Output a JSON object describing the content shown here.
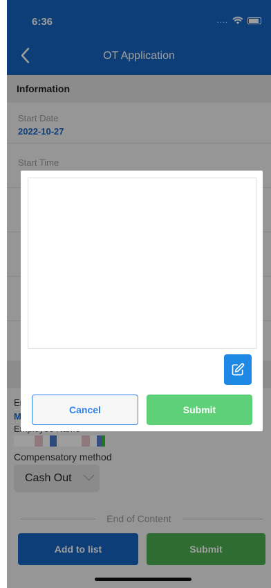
{
  "status_bar": {
    "time": "6:36",
    "signal": "....",
    "icons": [
      "wifi-icon",
      "battery-icon"
    ]
  },
  "nav": {
    "title": "OT Application",
    "back_icon": "chevron-left-icon"
  },
  "information": {
    "section_label": "Information",
    "fields": [
      {
        "label": "Start Date",
        "value": "2022-10-27"
      },
      {
        "label": "Start Time",
        "value": ""
      }
    ]
  },
  "employee": {
    "label_partial": "Er",
    "value_partial": "M",
    "name_label": "Employee Name"
  },
  "compensation": {
    "label": "Compensatory method",
    "selected": "Cash Out"
  },
  "end_of_content": "End of Content",
  "footer": {
    "add_label": "Add to list",
    "submit_label": "Submit"
  },
  "dialog": {
    "edit_icon": "edit-icon",
    "cancel_label": "Cancel",
    "submit_label": "Submit"
  },
  "colors": {
    "primary": "#1565c0",
    "dialog_submit": "#5dd078",
    "dialog_cancel_border": "#2f80ed",
    "edit_button": "#1e88e5",
    "footer_submit": "#4caf50"
  }
}
